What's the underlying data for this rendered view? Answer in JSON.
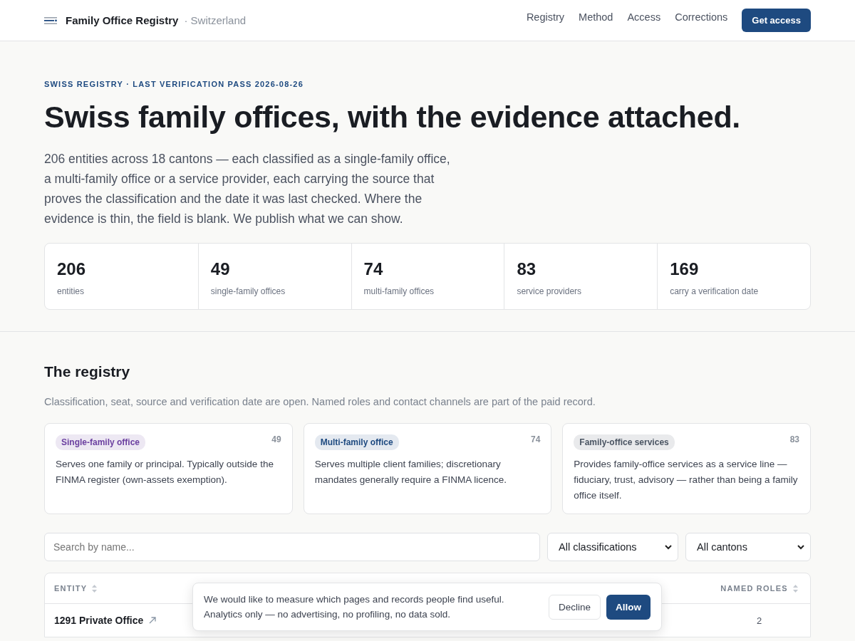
{
  "header": {
    "brand": "Family Office Registry",
    "country": "· Switzerland",
    "nav": [
      {
        "label": "Registry"
      },
      {
        "label": "Method"
      },
      {
        "label": "Access"
      },
      {
        "label": "Corrections"
      }
    ],
    "cta": "Get access"
  },
  "hero": {
    "eyebrow": "SWISS REGISTRY · LAST VERIFICATION PASS 2026-08-26",
    "title": "Swiss family offices, with the evidence attached.",
    "lead": "206 entities across 18 cantons — each classified as a single-family office, a multi-family office or a service provider, each carrying the source that proves the classification and the date it was last checked. Where the evidence is thin, the field is blank. We publish what we can show.",
    "stats": [
      {
        "value": "206",
        "label": "entities"
      },
      {
        "value": "49",
        "label": "single-family offices"
      },
      {
        "value": "74",
        "label": "multi-family offices"
      },
      {
        "value": "83",
        "label": "service providers"
      },
      {
        "value": "169",
        "label": "carry a verification date"
      }
    ]
  },
  "registry": {
    "title": "The registry",
    "subtitle": "Classification, seat, source and verification date are open. Named roles and contact channels are part of the paid record.",
    "categories": [
      {
        "tag": "Single-family office",
        "count": "49",
        "color": "#6b3fa0",
        "description": "Serves one family or principal. Typically outside the FINMA register (own-assets exemption)."
      },
      {
        "tag": "Multi-family office",
        "count": "74",
        "color": "#1e4a80",
        "description": "Serves multiple client families; discretionary mandates generally require a FINMA licence."
      },
      {
        "tag": "Family-office services",
        "count": "83",
        "color": "#4b5563",
        "description": "Provides family-office services as a service line — fiduciary, trust, advisory — rather than being a family office itself."
      }
    ],
    "search": {
      "placeholder": "Search by name..."
    },
    "filters": [
      {
        "value": "All classifications"
      },
      {
        "value": "All cantons"
      }
    ],
    "table": {
      "columns": [
        {
          "label": "ENTITY"
        },
        {
          "label": "NAMED ROLES"
        }
      ],
      "rows": [
        {
          "entity": "1291 Private Office",
          "named_roles": "2"
        }
      ]
    }
  },
  "cookie_banner": {
    "text": "We would like to measure which pages and records people find useful. Analytics only — no advertising, no profiling, no data sold.",
    "decline": "Decline",
    "allow": "Allow"
  }
}
